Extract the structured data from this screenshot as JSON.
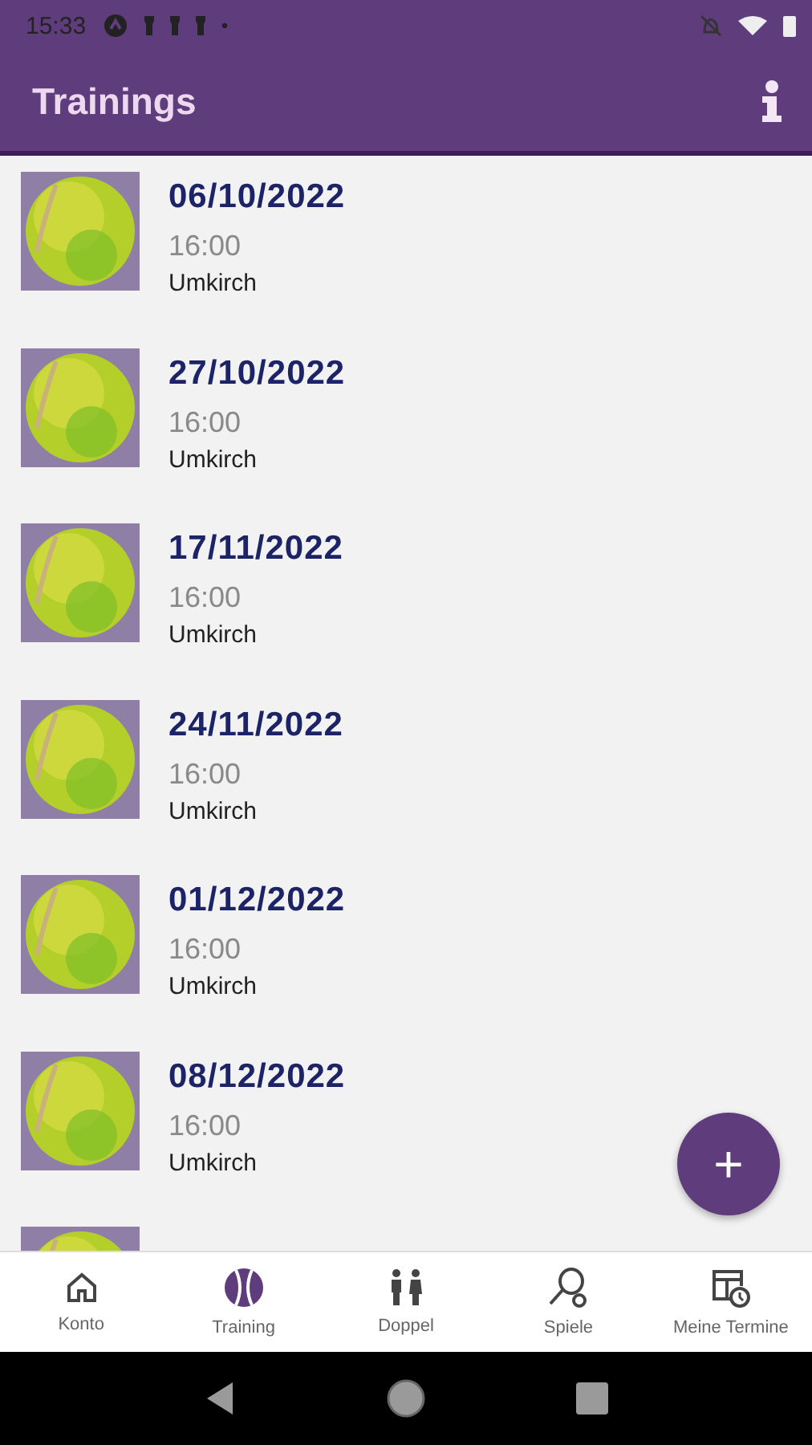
{
  "status_bar": {
    "time": "15:33"
  },
  "app_bar": {
    "title": "Trainings"
  },
  "trainings": [
    {
      "kind": "full",
      "date": "06/10/2022",
      "time": "16:00",
      "place": "Umkirch"
    },
    {
      "kind": "full",
      "date": "27/10/2022",
      "time": "16:00",
      "place": "Umkirch"
    },
    {
      "kind": "full",
      "date": "17/11/2022",
      "time": "16:00",
      "place": "Umkirch"
    },
    {
      "kind": "full",
      "date": "24/11/2022",
      "time": "16:00",
      "place": "Umkirch"
    },
    {
      "kind": "full",
      "date": "01/12/2022",
      "time": "16:00",
      "place": "Umkirch"
    },
    {
      "kind": "full",
      "date": "08/12/2022",
      "time": "16:00",
      "place": "Umkirch"
    },
    {
      "kind": "partial"
    }
  ],
  "fab": {
    "label": "+"
  },
  "bottom_nav": [
    {
      "kind": "home",
      "label": "Konto",
      "selected": false
    },
    {
      "kind": "ball",
      "label": "Training",
      "selected": true
    },
    {
      "kind": "people",
      "label": "Doppel",
      "selected": false
    },
    {
      "kind": "racket",
      "label": "Spiele",
      "selected": false
    },
    {
      "kind": "calendar",
      "label": "Meine Termine",
      "selected": false
    }
  ]
}
